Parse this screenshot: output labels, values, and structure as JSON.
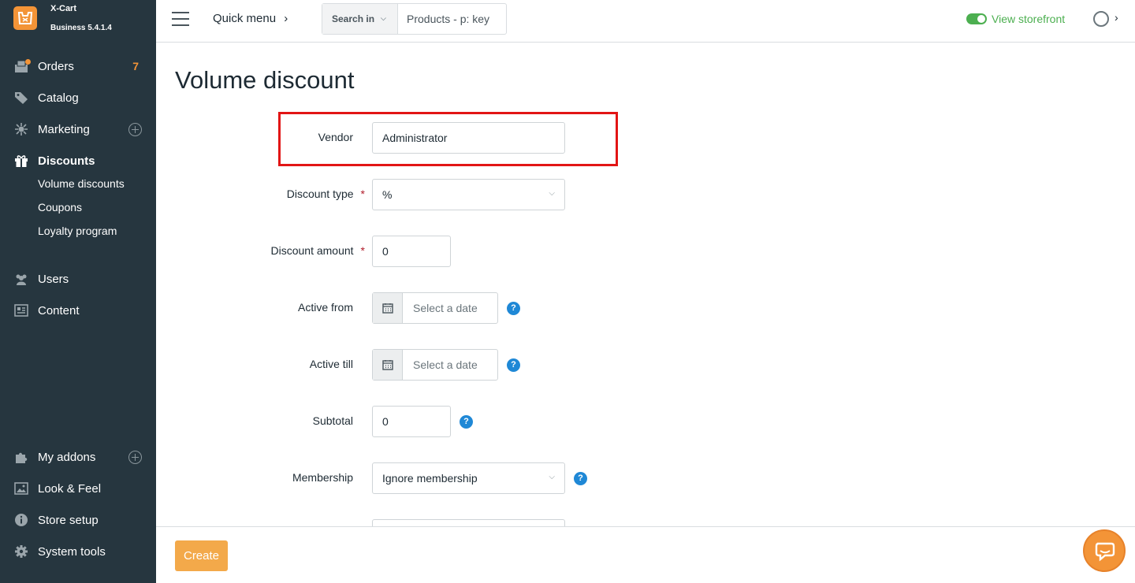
{
  "brand": {
    "name": "X-Cart",
    "version": "Business 5.4.1.4"
  },
  "sidebar": {
    "items": [
      {
        "label": "Orders",
        "icon": "orders-icon",
        "count": "7"
      },
      {
        "label": "Catalog",
        "icon": "tag-icon"
      },
      {
        "label": "Marketing",
        "icon": "marketing-icon"
      },
      {
        "label": "Discounts",
        "icon": "gift-icon",
        "active": true
      },
      {
        "label": "Users",
        "icon": "users-icon"
      },
      {
        "label": "Content",
        "icon": "content-icon"
      },
      {
        "label": "My addons",
        "icon": "puzzle-icon"
      },
      {
        "label": "Look & Feel",
        "icon": "image-icon"
      },
      {
        "label": "Store setup",
        "icon": "info-icon"
      },
      {
        "label": "System tools",
        "icon": "gear-icon"
      }
    ],
    "discounts_sub": [
      "Volume discounts",
      "Coupons",
      "Loyalty program"
    ]
  },
  "topbar": {
    "quick_menu": "Quick menu",
    "search_in": "Search in",
    "search_placeholder": "Products - p: key",
    "storefront": "View storefront"
  },
  "page": {
    "title": "Volume discount"
  },
  "form": {
    "vendor": {
      "label": "Vendor",
      "value": "Administrator"
    },
    "discount_type": {
      "label": "Discount type",
      "value": "%",
      "required": "*"
    },
    "discount_amount": {
      "label": "Discount amount",
      "value": "0",
      "required": "*"
    },
    "active_from": {
      "label": "Active from",
      "placeholder": "Select a date"
    },
    "active_till": {
      "label": "Active till",
      "placeholder": "Select a date"
    },
    "subtotal": {
      "label": "Subtotal",
      "value": "0"
    },
    "membership": {
      "label": "Membership",
      "value": "Ignore membership"
    }
  },
  "footer": {
    "create": "Create"
  },
  "help_glyph": "?",
  "colors": {
    "sidebar_bg": "#26363f",
    "accent": "#f39437",
    "highlight": "#e21515",
    "help": "#1f88d6",
    "storefront": "#4caf50"
  }
}
